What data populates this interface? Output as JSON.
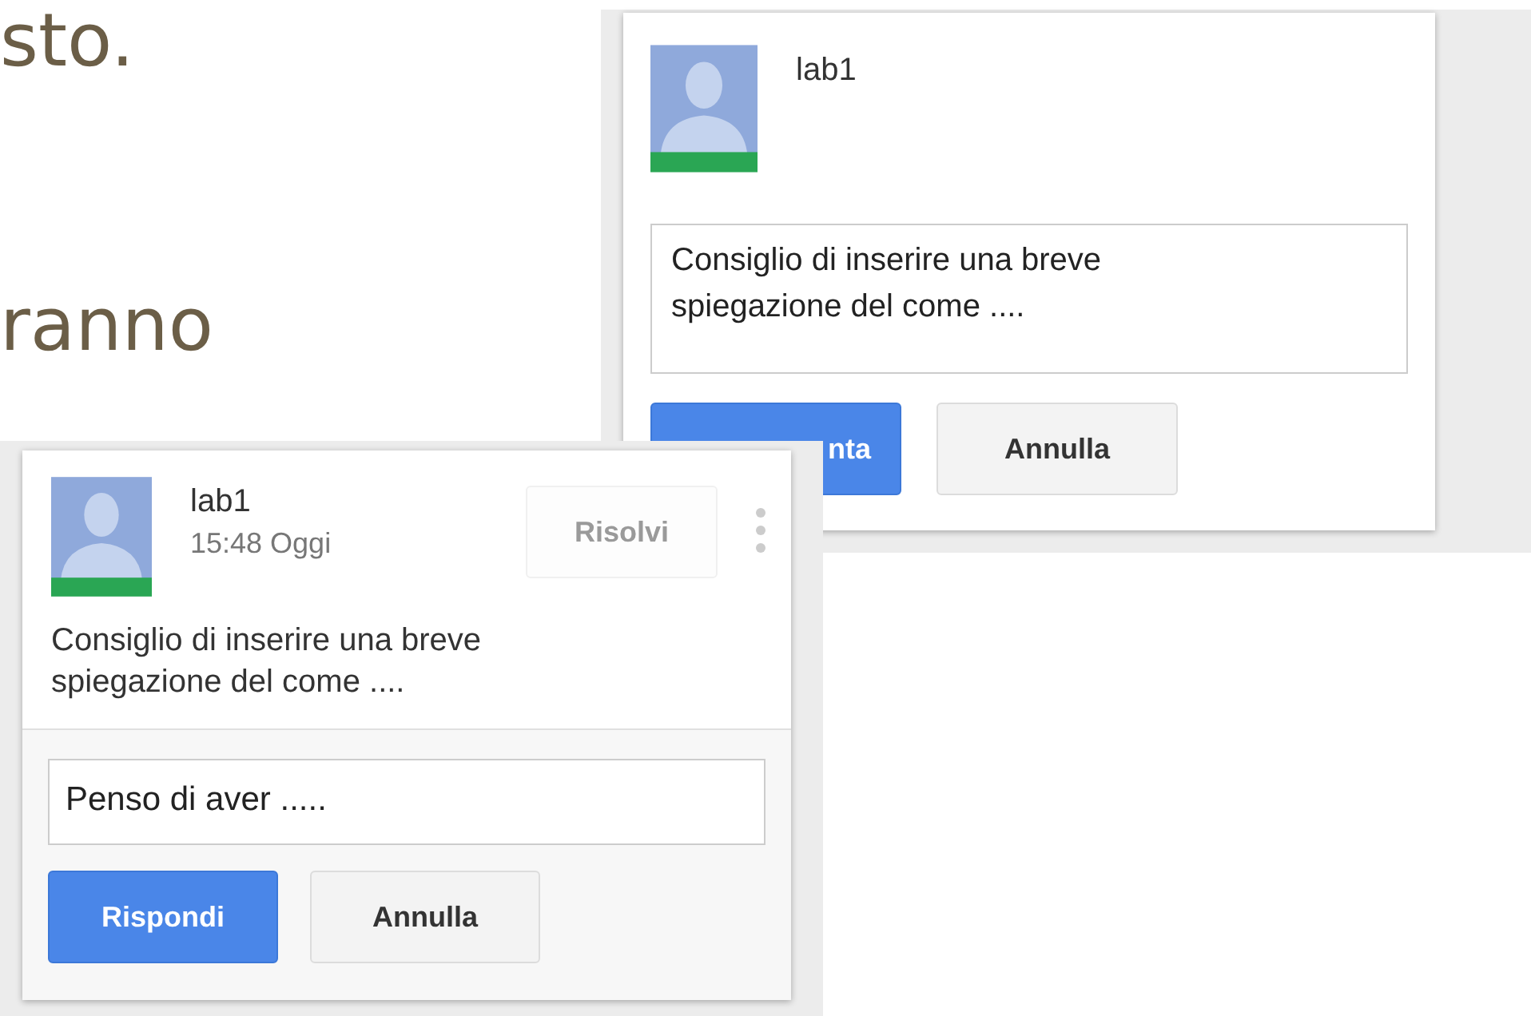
{
  "slide": {
    "lines": [
      "sto.",
      "ranno"
    ]
  },
  "comment_draft": {
    "author": "lab1",
    "value": "Consiglio di inserire una breve spiegazione del come ....",
    "buttons": [
      {
        "label": "nta",
        "kind": "primary"
      },
      {
        "label": "Annulla",
        "kind": "secondary"
      }
    ]
  },
  "comment_thread": {
    "author": "lab1",
    "time": "15:48 Oggi",
    "resolve": {
      "label": "Risolvi",
      "disabled": true
    },
    "text": "Consiglio di inserire una breve spiegazione del come ....",
    "reply": {
      "value": "Penso di aver .....",
      "buttons": [
        {
          "label": "Rispondi",
          "kind": "primary"
        },
        {
          "label": "Annulla",
          "kind": "secondary"
        }
      ]
    }
  }
}
